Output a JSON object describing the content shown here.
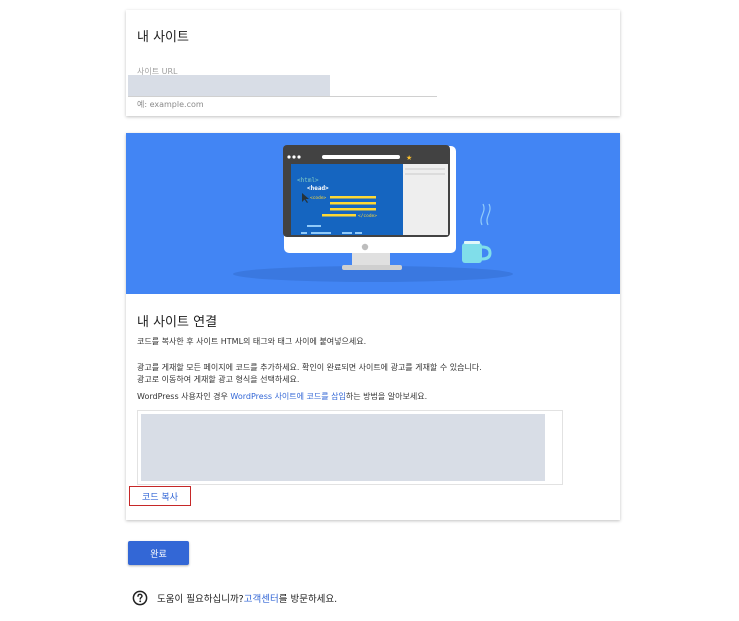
{
  "site": {
    "title": "내 사이트",
    "url_label": "사이트 URL",
    "url_value": "",
    "url_hint": "예: example.com"
  },
  "connect": {
    "title": "내 사이트 연결",
    "p1": "코드를 복사한 후 사이트 HTML의 태그와 태그 사이에 붙여넣으세요.",
    "p2": "광고를 게재할 모든 페이지에 코드를 추가하세요. 확인이 완료되면 사이트에 광고를 게재할 수 있습니다.",
    "p3": "광고로 이동하여 게재할 광고 형식을 선택하세요.",
    "wp_prefix": "WordPress 사용자인 경우 ",
    "wp_link": "WordPress 사이트에 코드를 삽입",
    "wp_suffix": "하는 방법을 알아보세요.",
    "copy_label": "코드 복사",
    "illustration": {
      "html_tag": "<html>",
      "head_tag": "<head>",
      "code_open": "<code>",
      "code_close": "</code>"
    }
  },
  "done_label": "완료",
  "help": {
    "prefix": "도움이 필요하십니까? ",
    "link": "고객센터",
    "suffix": "를 방문하세요."
  },
  "colors": {
    "banner": "#4285f4",
    "primary_button": "#3367d6",
    "link": "#3367d6",
    "highlight_border": "#c62828",
    "placeholder": "#d8dde6"
  },
  "icons": {
    "help": "help-circle-icon",
    "monitor": "monitor-illustration",
    "mug": "coffee-mug-illustration"
  }
}
